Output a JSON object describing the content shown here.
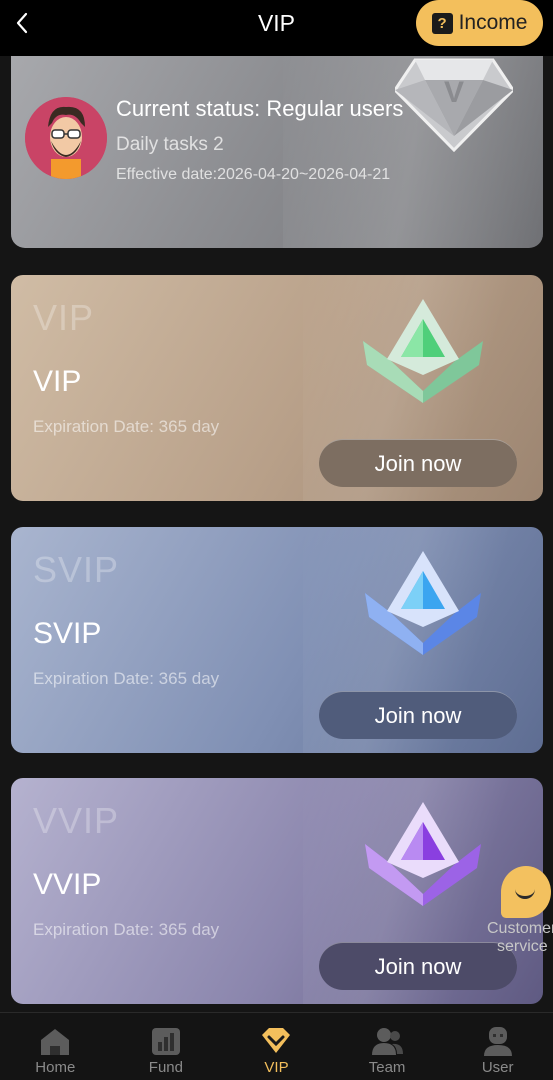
{
  "header": {
    "title": "VIP",
    "income_label": "Income"
  },
  "status": {
    "current_status": "Current status: Regular users",
    "daily_tasks": "Daily tasks 2",
    "effective_date": "Effective date:2026-04-20~2026-04-21"
  },
  "tiers": [
    {
      "ghost": "VIP",
      "name": "VIP",
      "expiration": "Expiration Date: 365 day",
      "button": "Join now"
    },
    {
      "ghost": "SVIP",
      "name": "SVIP",
      "expiration": "Expiration Date: 365 day",
      "button": "Join now"
    },
    {
      "ghost": "VVIP",
      "name": "VVIP",
      "expiration": "Expiration Date: 365 day",
      "button": "Join now"
    }
  ],
  "customer_service": {
    "line1": "Customer",
    "line2": "service"
  },
  "nav": [
    {
      "label": "Home",
      "icon": "home-icon"
    },
    {
      "label": "Fund",
      "icon": "fund-icon"
    },
    {
      "label": "VIP",
      "icon": "vip-icon",
      "active": true
    },
    {
      "label": "Team",
      "icon": "team-icon"
    },
    {
      "label": "User",
      "icon": "user-icon"
    }
  ],
  "colors": {
    "accent": "#f3bf5c",
    "vip_card": "#b8a089",
    "svip_card": "#8090b4",
    "vvip_card": "#8b86ad"
  }
}
